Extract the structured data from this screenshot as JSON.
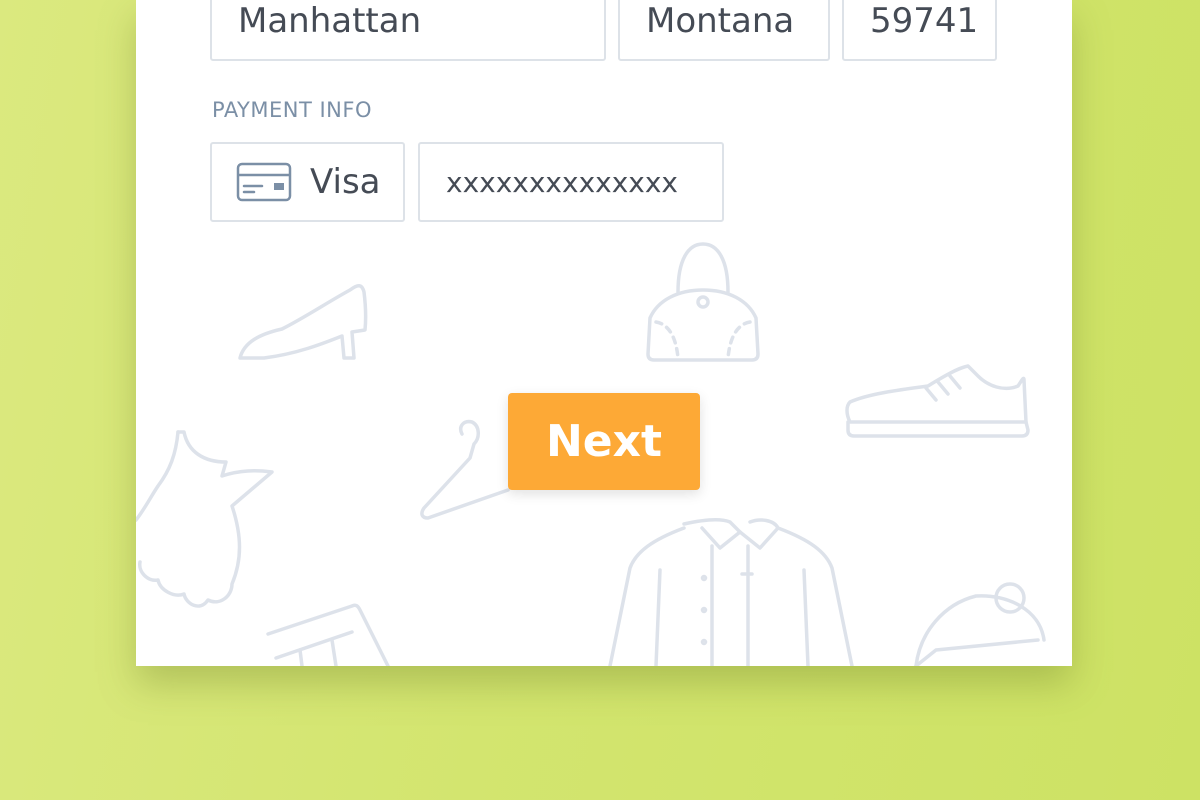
{
  "address": {
    "city": "Manhattan",
    "state": "Montana",
    "zip": "59741"
  },
  "payment": {
    "section_label": "PAYMENT INFO",
    "card_type": "Visa",
    "card_icon": "credit-card-icon",
    "card_number": "xxxxxxxxxxxxxx"
  },
  "actions": {
    "next_label": "Next"
  },
  "background_icons": [
    "high-heel-icon",
    "handbag-icon",
    "sneaker-icon",
    "dress-icon",
    "hanger-icon",
    "shirt-icon",
    "jeans-icon",
    "beanie-icon"
  ],
  "colors": {
    "background": "#d3e56f",
    "card": "#ffffff",
    "accent": "#fda936",
    "label": "#7b8fa6",
    "field_border": "#dde2e8",
    "text": "#454b55",
    "decor": "#dde2ea"
  }
}
